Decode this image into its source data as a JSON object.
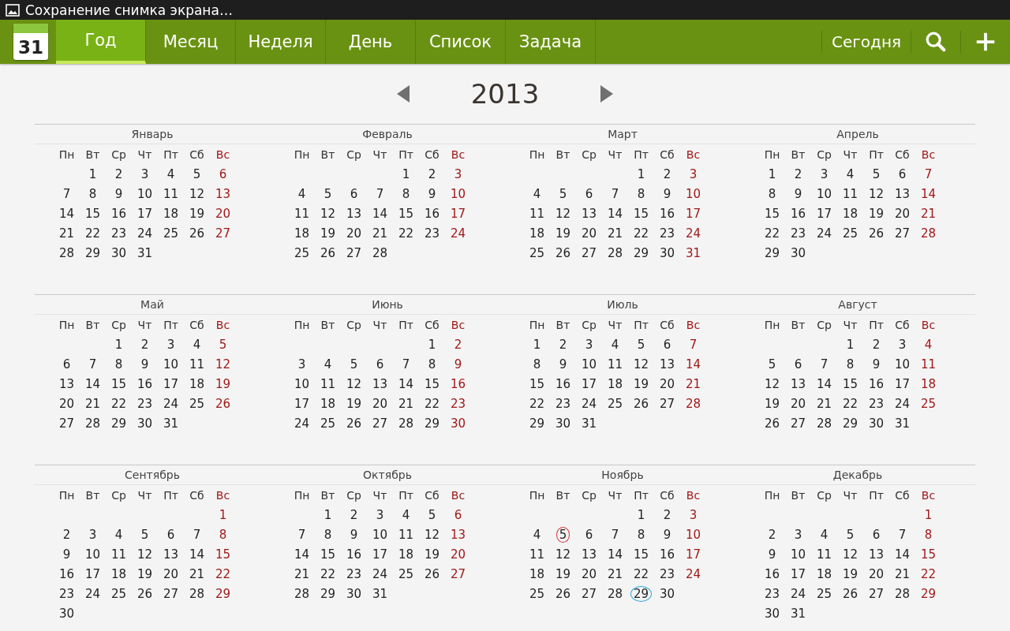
{
  "status_bar": {
    "notification": "Сохранение снимка экрана…"
  },
  "app_bar": {
    "logo_day": "31",
    "tabs": [
      {
        "label": "Год",
        "selected": true
      },
      {
        "label": "Месяц",
        "selected": false
      },
      {
        "label": "Неделя",
        "selected": false
      },
      {
        "label": "День",
        "selected": false
      },
      {
        "label": "Список",
        "selected": false
      },
      {
        "label": "Задача",
        "selected": false
      }
    ],
    "today_button": "Сегодня"
  },
  "year_nav": {
    "year": "2013"
  },
  "months": [
    {
      "name": "Январь",
      "starts_midweek": true,
      "weekdays": [
        "Пн",
        "Вт",
        "Ср",
        "Чт",
        "Пт",
        "Сб",
        "Вс"
      ],
      "weeks": [
        [
          "1",
          "2",
          "3",
          "4",
          "5",
          "6"
        ],
        [
          "7",
          "8",
          "9",
          "10",
          "11",
          "12",
          "13"
        ],
        [
          "14",
          "15",
          "16",
          "17",
          "18",
          "19",
          "20"
        ],
        [
          "21",
          "22",
          "23",
          "24",
          "25",
          "26",
          "27"
        ],
        [
          "28",
          "29",
          "30",
          "31"
        ]
      ]
    },
    {
      "name": "Февраль",
      "starts_midweek": true,
      "weekdays": [
        "Пн",
        "Вт",
        "Ср",
        "Чт",
        "Пт",
        "Сб",
        "Вс"
      ],
      "weeks": [
        [
          "1",
          "2",
          "3"
        ],
        [
          "4",
          "5",
          "6",
          "7",
          "8",
          "9",
          "10"
        ],
        [
          "11",
          "12",
          "13",
          "14",
          "15",
          "16",
          "17"
        ],
        [
          "18",
          "19",
          "20",
          "21",
          "22",
          "23",
          "24"
        ],
        [
          "25",
          "26",
          "27",
          "28"
        ]
      ]
    },
    {
      "name": "Март",
      "starts_midweek": true,
      "weekdays": [
        "Пн",
        "Вт",
        "Ср",
        "Чт",
        "Пт",
        "Сб",
        "Вс"
      ],
      "weeks": [
        [
          "1",
          "2",
          "3"
        ],
        [
          "4",
          "5",
          "6",
          "7",
          "8",
          "9",
          "10"
        ],
        [
          "11",
          "12",
          "13",
          "14",
          "15",
          "16",
          "17"
        ],
        [
          "18",
          "19",
          "20",
          "21",
          "22",
          "23",
          "24"
        ],
        [
          "25",
          "26",
          "27",
          "28",
          "29",
          "30",
          "31"
        ]
      ]
    },
    {
      "name": "Апрель",
      "weekdays": [
        "Пн",
        "Вт",
        "Ср",
        "Чт",
        "Пт",
        "Сб",
        "Вс"
      ],
      "weeks": [
        [
          "1",
          "2",
          "3",
          "4",
          "5",
          "6",
          "7"
        ],
        [
          "8",
          "9",
          "10",
          "11",
          "12",
          "13",
          "14"
        ],
        [
          "15",
          "16",
          "17",
          "18",
          "19",
          "20",
          "21"
        ],
        [
          "22",
          "23",
          "24",
          "25",
          "26",
          "27",
          "28"
        ],
        [
          "29",
          "30"
        ]
      ]
    },
    {
      "name": "Май",
      "starts_midweek": true,
      "weekdays": [
        "Пн",
        "Вт",
        "Ср",
        "Чт",
        "Пт",
        "Сб",
        "Вс"
      ],
      "weeks": [
        [
          "1",
          "2",
          "3",
          "4",
          "5"
        ],
        [
          "6",
          "7",
          "8",
          "9",
          "10",
          "11",
          "12"
        ],
        [
          "13",
          "14",
          "15",
          "16",
          "17",
          "18",
          "19"
        ],
        [
          "20",
          "21",
          "22",
          "23",
          "24",
          "25",
          "26"
        ],
        [
          "27",
          "28",
          "29",
          "30",
          "31"
        ]
      ]
    },
    {
      "name": "Июнь",
      "starts_midweek": true,
      "weekdays": [
        "Пн",
        "Вт",
        "Ср",
        "Чт",
        "Пт",
        "Сб",
        "Вс"
      ],
      "weeks": [
        [
          "1",
          "2"
        ],
        [
          "3",
          "4",
          "5",
          "6",
          "7",
          "8",
          "9"
        ],
        [
          "10",
          "11",
          "12",
          "13",
          "14",
          "15",
          "16"
        ],
        [
          "17",
          "18",
          "19",
          "20",
          "21",
          "22",
          "23"
        ],
        [
          "24",
          "25",
          "26",
          "27",
          "28",
          "29",
          "30"
        ]
      ]
    },
    {
      "name": "Июль",
      "weekdays": [
        "Пн",
        "Вт",
        "Ср",
        "Чт",
        "Пт",
        "Сб",
        "Вс"
      ],
      "weeks": [
        [
          "1",
          "2",
          "3",
          "4",
          "5",
          "6",
          "7"
        ],
        [
          "8",
          "9",
          "10",
          "11",
          "12",
          "13",
          "14"
        ],
        [
          "15",
          "16",
          "17",
          "18",
          "19",
          "20",
          "21"
        ],
        [
          "22",
          "23",
          "24",
          "25",
          "26",
          "27",
          "28"
        ],
        [
          "29",
          "30",
          "31"
        ]
      ]
    },
    {
      "name": "Август",
      "starts_midweek": true,
      "weekdays": [
        "Пн",
        "Вт",
        "Ср",
        "Чт",
        "Пт",
        "Сб",
        "Вс"
      ],
      "weeks": [
        [
          "1",
          "2",
          "3",
          "4"
        ],
        [
          "5",
          "6",
          "7",
          "8",
          "9",
          "10",
          "11"
        ],
        [
          "12",
          "13",
          "14",
          "15",
          "16",
          "17",
          "18"
        ],
        [
          "19",
          "20",
          "21",
          "22",
          "23",
          "24",
          "25"
        ],
        [
          "26",
          "27",
          "28",
          "29",
          "30",
          "31"
        ]
      ]
    },
    {
      "name": "Сентябрь",
      "starts_midweek": true,
      "weekdays": [
        "Пн",
        "Вт",
        "Ср",
        "Чт",
        "Пт",
        "Сб",
        "Вс"
      ],
      "weeks": [
        [
          "1"
        ],
        [
          "2",
          "3",
          "4",
          "5",
          "6",
          "7",
          "8"
        ],
        [
          "9",
          "10",
          "11",
          "12",
          "13",
          "14",
          "15"
        ],
        [
          "16",
          "17",
          "18",
          "19",
          "20",
          "21",
          "22"
        ],
        [
          "23",
          "24",
          "25",
          "26",
          "27",
          "28",
          "29"
        ],
        [
          "30"
        ]
      ]
    },
    {
      "name": "Октябрь",
      "starts_midweek": true,
      "weekdays": [
        "Пн",
        "Вт",
        "Ср",
        "Чт",
        "Пт",
        "Сб",
        "Вс"
      ],
      "weeks": [
        [
          "1",
          "2",
          "3",
          "4",
          "5",
          "6"
        ],
        [
          "7",
          "8",
          "9",
          "10",
          "11",
          "12",
          "13"
        ],
        [
          "14",
          "15",
          "16",
          "17",
          "18",
          "19",
          "20"
        ],
        [
          "21",
          "22",
          "23",
          "24",
          "25",
          "26",
          "27"
        ],
        [
          "28",
          "29",
          "30",
          "31"
        ]
      ]
    },
    {
      "name": "Ноябрь",
      "starts_midweek": true,
      "weekdays": [
        "Пн",
        "Вт",
        "Ср",
        "Чт",
        "Пт",
        "Сб",
        "Вс"
      ],
      "weeks": [
        [
          "1",
          "2",
          "3"
        ],
        [
          "4",
          {
            "text": "5",
            "color": "#d03a3a"
          },
          "6",
          "7",
          "8",
          "9",
          "10"
        ],
        [
          "11",
          "12",
          "13",
          "14",
          "15",
          "16",
          "17"
        ],
        [
          "18",
          "19",
          "20",
          "21",
          "22",
          "23",
          "24"
        ],
        [
          "25",
          "26",
          "27",
          "28",
          {
            "text": "29",
            "color": "#2ea6dc"
          },
          "30"
        ]
      ]
    },
    {
      "name": "Декабрь",
      "starts_midweek": true,
      "weekdays": [
        "Пн",
        "Вт",
        "Ср",
        "Чт",
        "Пт",
        "Сб",
        "Вс"
      ],
      "weeks": [
        [
          "1"
        ],
        [
          "2",
          "3",
          "4",
          "5",
          "6",
          "7",
          "8"
        ],
        [
          "9",
          "10",
          "11",
          "12",
          "13",
          "14",
          "15"
        ],
        [
          "16",
          "17",
          "18",
          "19",
          "20",
          "21",
          "22"
        ],
        [
          "23",
          "24",
          "25",
          "26",
          "27",
          "28",
          "29"
        ],
        [
          "30",
          "31"
        ]
      ]
    }
  ]
}
